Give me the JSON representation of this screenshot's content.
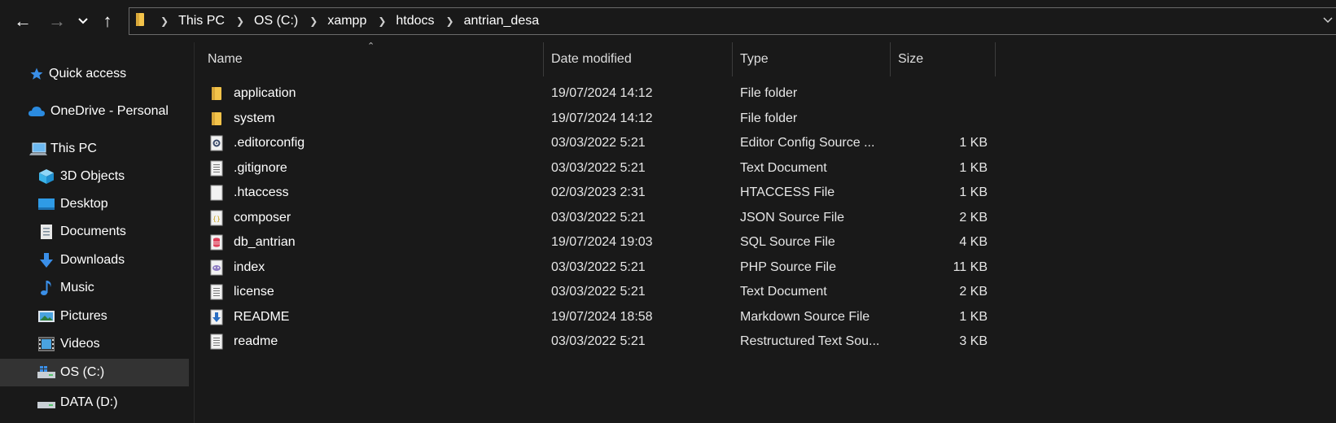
{
  "toolbar": {
    "back_icon": "←",
    "forward_icon": "→",
    "recent_icon": "⌄",
    "up_icon": "↑"
  },
  "address_bar": {
    "crumbs": [
      "This PC",
      "OS (C:)",
      "xampp",
      "htdocs",
      "antrian_desa"
    ]
  },
  "sidebar": {
    "items": [
      {
        "label": "Quick access",
        "icon": "star-icon"
      },
      {
        "label": "OneDrive - Personal",
        "icon": "cloud-icon"
      },
      {
        "label": "This PC",
        "icon": "computer-icon"
      },
      {
        "label": "3D Objects",
        "icon": "cube-icon"
      },
      {
        "label": "Desktop",
        "icon": "desktop-icon"
      },
      {
        "label": "Documents",
        "icon": "documents-icon"
      },
      {
        "label": "Downloads",
        "icon": "download-icon"
      },
      {
        "label": "Music",
        "icon": "music-icon"
      },
      {
        "label": "Pictures",
        "icon": "pictures-icon"
      },
      {
        "label": "Videos",
        "icon": "videos-icon"
      },
      {
        "label": "OS (C:)",
        "icon": "drive-icon"
      },
      {
        "label": "DATA (D:)",
        "icon": "drive-icon"
      }
    ]
  },
  "columns": {
    "name": "Name",
    "date": "Date modified",
    "type": "Type",
    "size": "Size"
  },
  "files": [
    {
      "name": "application",
      "date": "19/07/2024 14:12",
      "type": "File folder",
      "size": "",
      "icon": "folder-icon"
    },
    {
      "name": "system",
      "date": "19/07/2024 14:12",
      "type": "File folder",
      "size": "",
      "icon": "folder-icon"
    },
    {
      "name": ".editorconfig",
      "date": "03/03/2022 5:21",
      "type": "Editor Config Source ...",
      "size": "1 KB",
      "icon": "config-file-icon"
    },
    {
      "name": ".gitignore",
      "date": "03/03/2022 5:21",
      "type": "Text Document",
      "size": "1 KB",
      "icon": "text-file-icon"
    },
    {
      "name": ".htaccess",
      "date": "02/03/2023 2:31",
      "type": "HTACCESS File",
      "size": "1 KB",
      "icon": "blank-file-icon"
    },
    {
      "name": "composer",
      "date": "03/03/2022 5:21",
      "type": "JSON Source File",
      "size": "2 KB",
      "icon": "json-file-icon"
    },
    {
      "name": "db_antrian",
      "date": "19/07/2024 19:03",
      "type": "SQL Source File",
      "size": "4 KB",
      "icon": "sql-file-icon"
    },
    {
      "name": "index",
      "date": "03/03/2022 5:21",
      "type": "PHP Source File",
      "size": "11 KB",
      "icon": "php-file-icon"
    },
    {
      "name": "license",
      "date": "03/03/2022 5:21",
      "type": "Text Document",
      "size": "2 KB",
      "icon": "text-file-icon"
    },
    {
      "name": "README",
      "date": "19/07/2024 18:58",
      "type": "Markdown Source File",
      "size": "1 KB",
      "icon": "markdown-file-icon"
    },
    {
      "name": "readme",
      "date": "03/03/2022 5:21",
      "type": "Restructured Text Sou...",
      "size": "3 KB",
      "icon": "text-file-icon"
    }
  ],
  "colors": {
    "background": "#191919",
    "selected": "#333333",
    "folder": "#f3c34a",
    "accent": "#1e90ff"
  }
}
